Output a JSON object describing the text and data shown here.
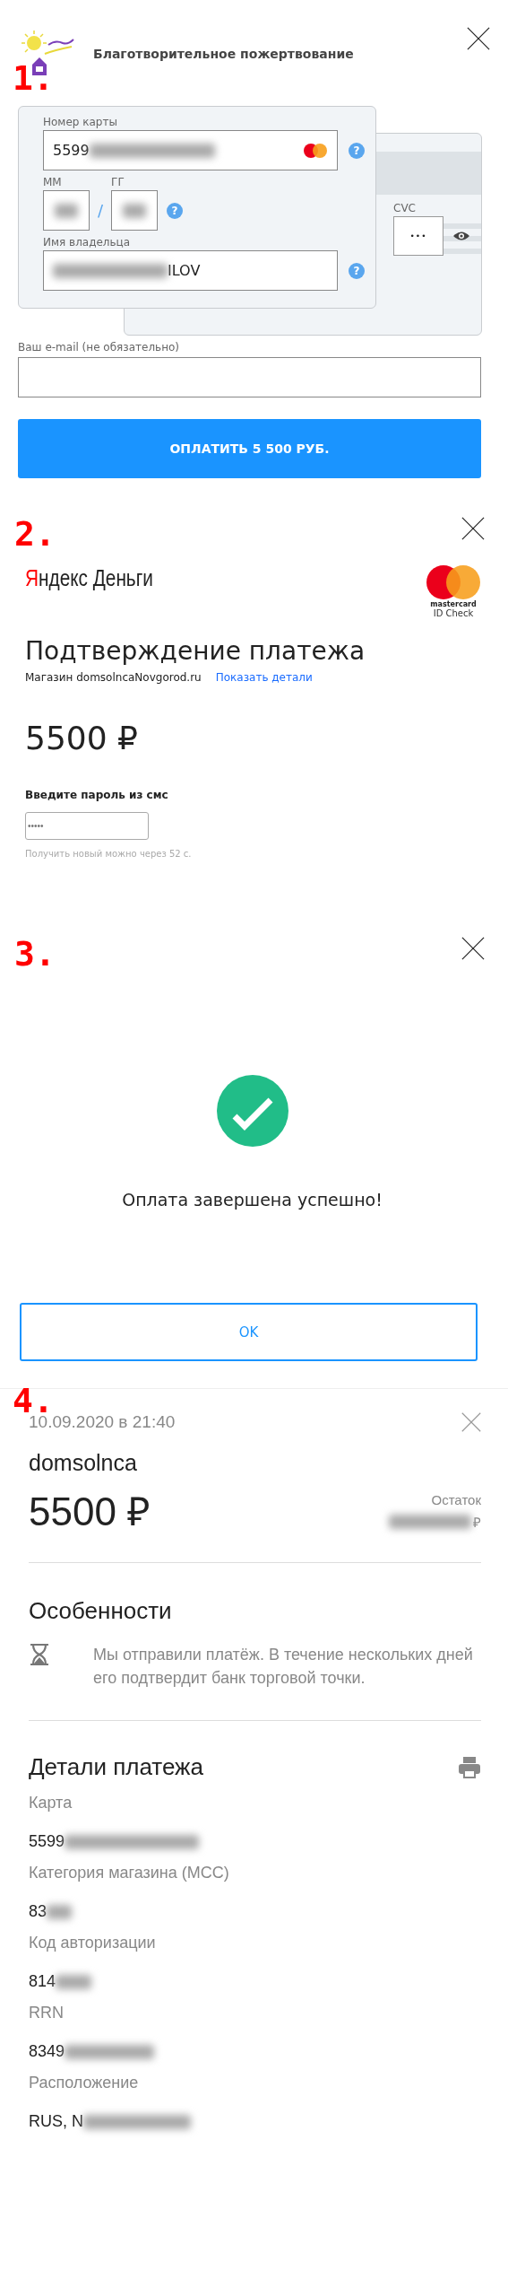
{
  "payment_form": {
    "step": "1.",
    "title": "Благотворительное пожертвование",
    "number_label": "Номер карты",
    "number_value": "5599",
    "number_help": "?",
    "month_label": "ММ",
    "separator": "/",
    "year_label": "ГГ",
    "expiry_help": "?",
    "holder_label": "Имя владельца",
    "holder_value": "ILOV",
    "holder_help": "?",
    "cvc_label": "CVC",
    "cvc_value": "•••",
    "email_label": "Ваш e-mail (не обязательно)",
    "pay_button": "ОПЛАТИТЬ 5 500 РУБ."
  },
  "confirmation": {
    "step": "2.",
    "logo_initial": "Я",
    "logo_rest": "ндекс Деньги",
    "mc_brand": "mastercard",
    "mc_check": "ID Check",
    "heading": "Подтверждение платежа",
    "shop": "Магазин domsolncaNovgorod.ru",
    "details_link": "Показать детали",
    "amount": "5500 ₽",
    "sms_label": "Введите пароль из смс",
    "sms_placeholder": "•••••",
    "resend_hint": "Получить новый можно через 52 с."
  },
  "success": {
    "step": "3.",
    "message": "Оплата завершена успешно!",
    "ok_button": "OK"
  },
  "receipt": {
    "step": "4.",
    "date": "10.09.2020 в 21:40",
    "merchant": "domsolnca",
    "amount": "5500 ₽",
    "balance_label": "Остаток",
    "balance_currency": "₽",
    "features_title": "Особенности",
    "features_text": "Мы отправили платёж. В течение нескольких дней его подтвердит банк торговой точки.",
    "details_title": "Детали платежа",
    "rows": [
      {
        "label": "Карта",
        "value": "5599"
      },
      {
        "label": "Категория магазина (МСС)",
        "value": "83"
      },
      {
        "label": "Код авторизации",
        "value": "814"
      },
      {
        "label": "RRN",
        "value": "8349"
      },
      {
        "label": "Расположение",
        "value": "RUS, N"
      }
    ]
  }
}
